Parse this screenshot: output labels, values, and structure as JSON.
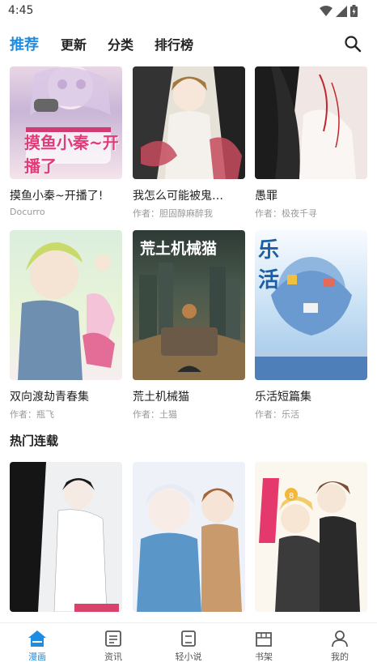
{
  "status": {
    "time": "4:45"
  },
  "tabs": [
    {
      "label": "推荐",
      "active": true
    },
    {
      "label": "更新",
      "active": false
    },
    {
      "label": "分类",
      "active": false
    },
    {
      "label": "排行榜",
      "active": false
    }
  ],
  "row1": [
    {
      "title": "摸鱼小秦~开播了!",
      "sub": "Docurro",
      "cover_text": "摸鱼小秦~开播了"
    },
    {
      "title": "我怎么可能被鬼…",
      "sub": "作者：胆固醇麻醉我",
      "cover_text": ""
    },
    {
      "title": "愚罪",
      "sub": "作者：极夜千寻",
      "cover_text": ""
    }
  ],
  "row2": [
    {
      "title": "双向渡劫青春集",
      "sub": "作者：瓶飞",
      "cover_text": ""
    },
    {
      "title": "荒土机械猫",
      "sub": "作者：土猫",
      "cover_text": "荒土机械猫"
    },
    {
      "title": "乐活短篇集",
      "sub": "作者：乐活",
      "cover_text": "乐 活"
    }
  ],
  "hot_section": {
    "title": "热门连载"
  },
  "row3": [
    {
      "title": "",
      "sub": ""
    },
    {
      "title": "",
      "sub": ""
    },
    {
      "title": "",
      "sub": ""
    }
  ],
  "bottom_nav": [
    {
      "label": "漫画",
      "icon": "home-icon",
      "active": true
    },
    {
      "label": "资讯",
      "icon": "news-icon",
      "active": false
    },
    {
      "label": "轻小说",
      "icon": "book-icon",
      "active": false
    },
    {
      "label": "书架",
      "icon": "shelf-icon",
      "active": false
    },
    {
      "label": "我的",
      "icon": "profile-icon",
      "active": false
    }
  ],
  "colors": {
    "accent": "#1e8ce0"
  }
}
